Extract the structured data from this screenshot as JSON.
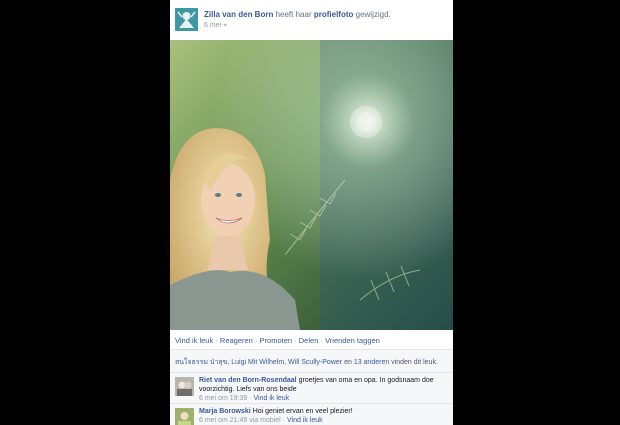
{
  "post": {
    "author": "Zilla van den Born",
    "action_pre": "heeft haar",
    "action_link": "profielfoto",
    "action_post": "gewijzigd.",
    "date": "6 mei",
    "audience_icon": "globe-icon"
  },
  "actions": {
    "like": "Vind ik leuk",
    "comment": "Reageren",
    "promote": "Promoten",
    "share": "Delen",
    "tag": "Vrienden taggen",
    "separator": "·"
  },
  "likes": {
    "names": "สนใจธรรม ป่าสุข, Luigi Mit Wilhelm, Will Scully-Power",
    "and_text": "en",
    "others": "13 anderen",
    "suffix": "vinden dit leuk."
  },
  "comments": [
    {
      "name": "Riet van den Born-Rosendaal",
      "text": "groetjes van oma en opa. In godsnaam doe voorzichtig. Liefs van ons beide",
      "time": "6 mei om 19:39",
      "like": "Vind ik leuk"
    },
    {
      "name": "Marja Borowski",
      "text": "Hoi geniet ervan en veel plezier!",
      "time": "6 mei om 21:49 via mobiel",
      "like": "Vind ik leuk"
    }
  ],
  "colors": {
    "link": "#3b5998",
    "muted": "#9197a3",
    "panel": "#f6f7f9"
  }
}
